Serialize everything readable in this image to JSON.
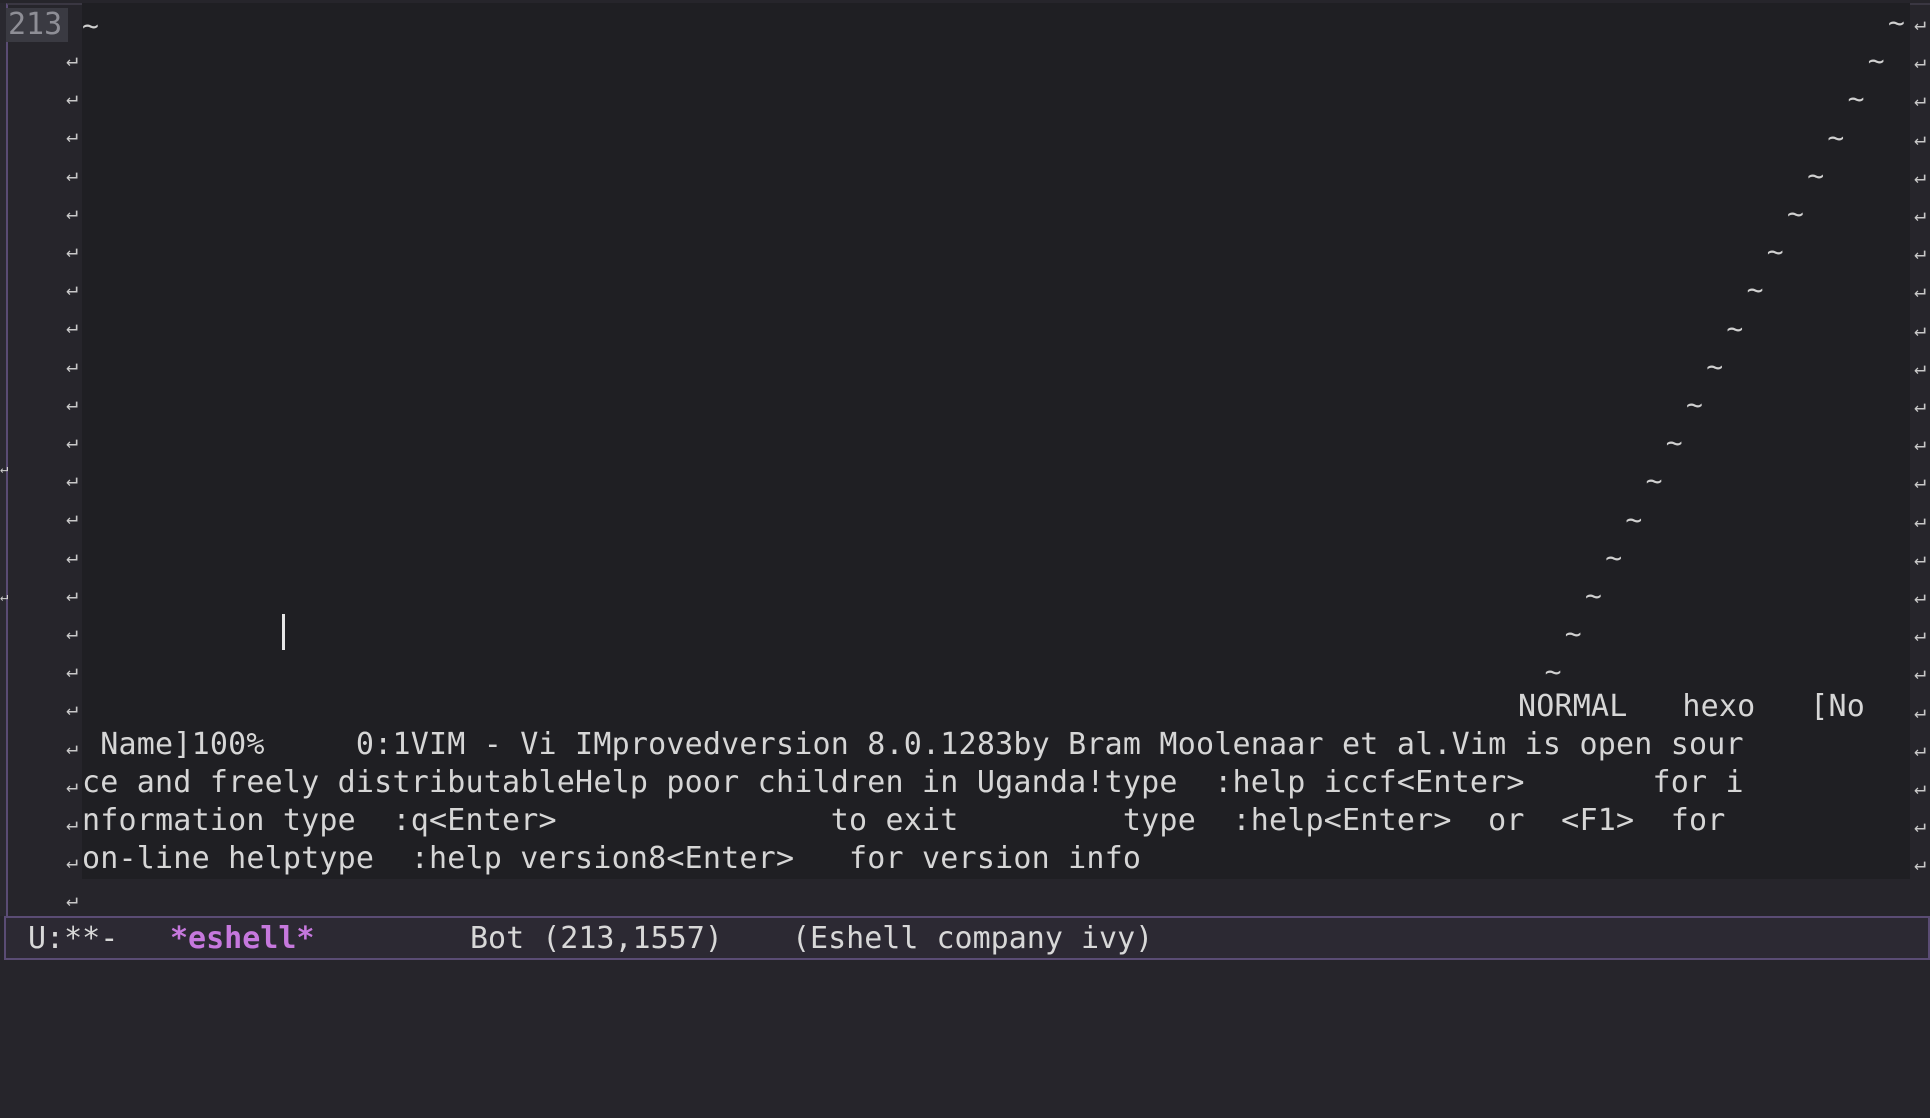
{
  "editor": {
    "line_number": "213",
    "tilde": "~",
    "wrap_glyph": "↵",
    "status_row": "NORMAL   hexo   [No",
    "lines": [
      " Name]100%     0:1VIM - Vi IMprovedversion 8.0.1283by Bram Moolenaar et al.Vim is open sour",
      "ce and freely distributableHelp poor children in Uganda!type  :help iccf<Enter>       for i",
      "nformation type  :q<Enter>               to exit         type  :help<Enter>  or  <F1>  for",
      "on-line helptype  :help version8<Enter>   for version info"
    ]
  },
  "modeline": {
    "state": "U:**-",
    "buffer": "*eshell*",
    "position": "Bot (213,1557)",
    "modes": "(Eshell company ivy)"
  }
}
